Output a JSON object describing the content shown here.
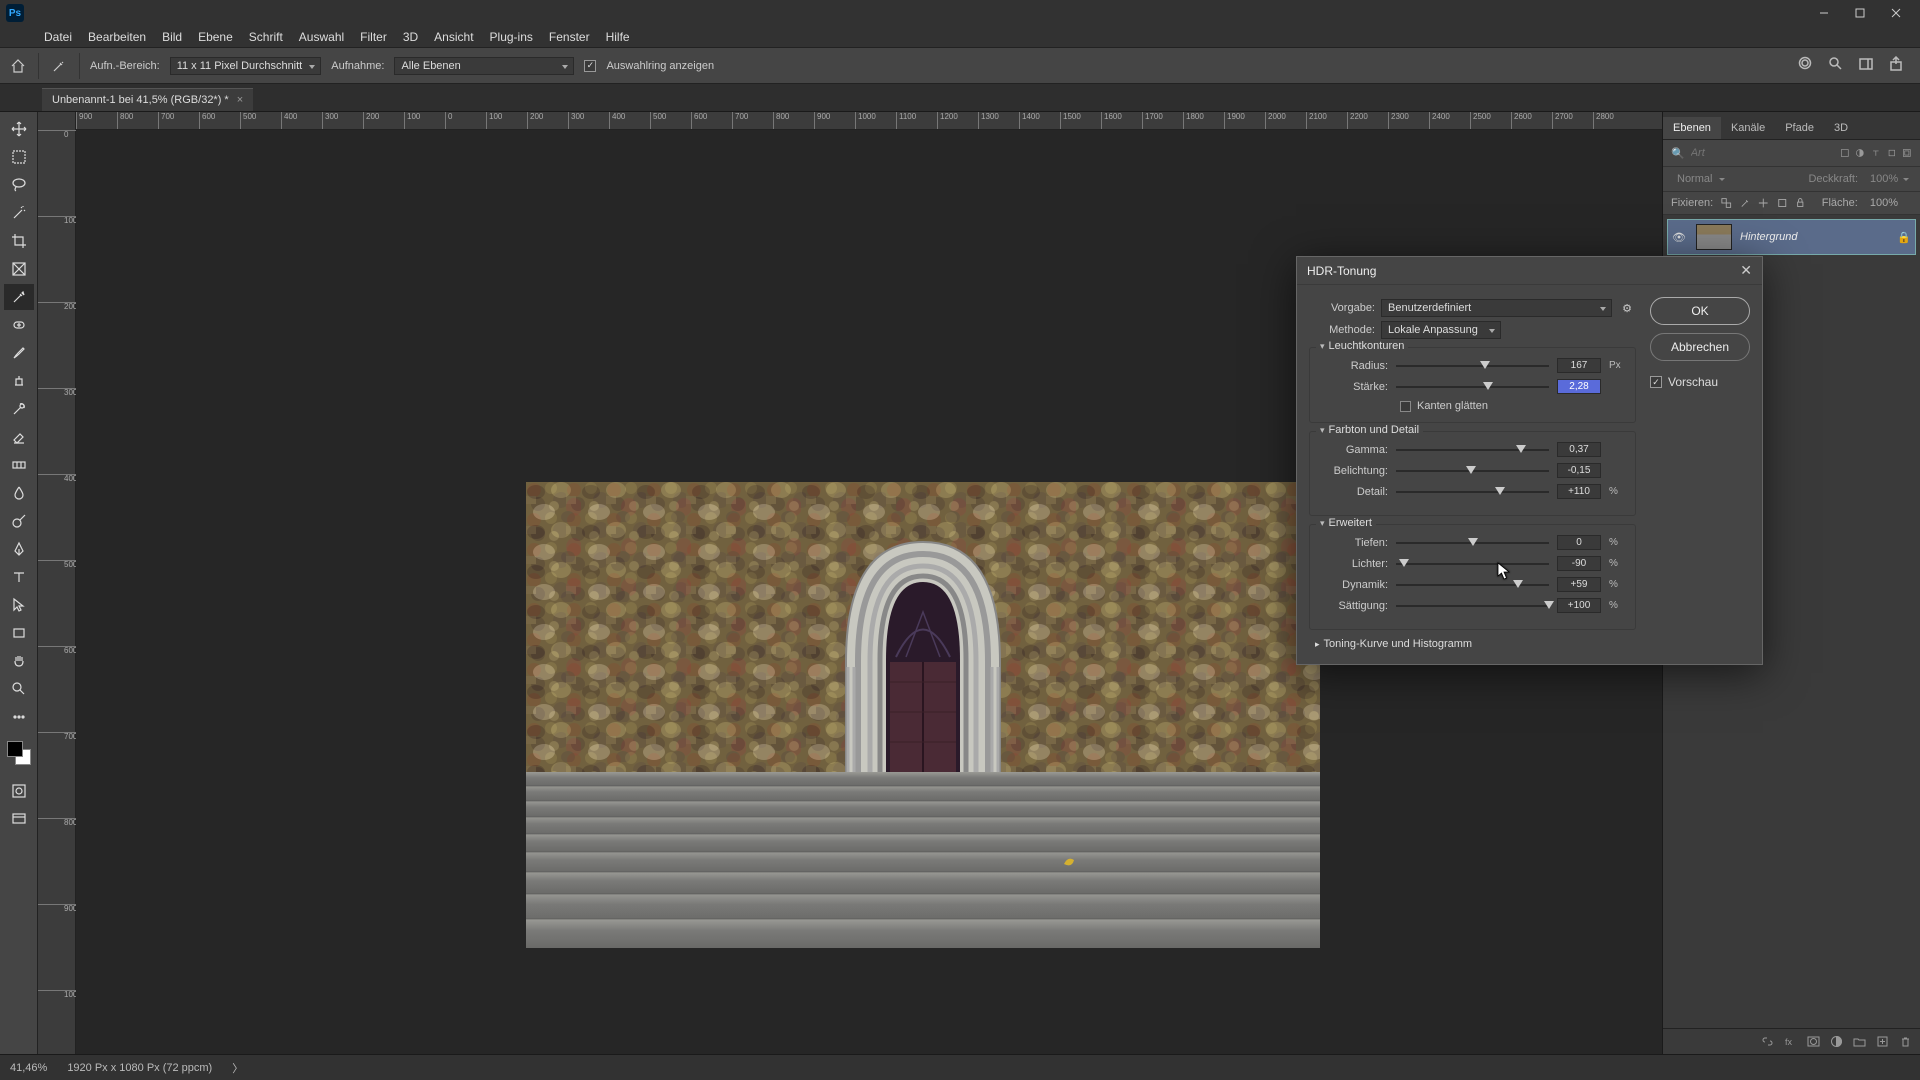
{
  "menubar": [
    "Datei",
    "Bearbeiten",
    "Bild",
    "Ebene",
    "Schrift",
    "Auswahl",
    "Filter",
    "3D",
    "Ansicht",
    "Plug-ins",
    "Fenster",
    "Hilfe"
  ],
  "optionsbar": {
    "sample_label": "Aufn.-Bereich:",
    "sample_value": "11 x 11 Pixel Durchschnitt",
    "sample_target_label": "Aufnahme:",
    "sample_target_value": "Alle Ebenen",
    "show_ring_label": "Auswahlring anzeigen"
  },
  "tab": {
    "title": "Unbenannt-1 bei 41,5% (RGB/32*) *"
  },
  "ruler_h": [
    "900",
    "800",
    "700",
    "600",
    "500",
    "400",
    "300",
    "200",
    "100",
    "0",
    "100",
    "200",
    "300",
    "400",
    "500",
    "600",
    "700",
    "800",
    "900",
    "1000",
    "1100",
    "1200",
    "1300",
    "1400",
    "1500",
    "1600",
    "1700",
    "1800",
    "1900",
    "2000",
    "2100",
    "2200",
    "2300",
    "2400",
    "2500",
    "2600",
    "2700",
    "2800"
  ],
  "ruler_v": [
    "0",
    "100",
    "200",
    "300",
    "400",
    "500",
    "600",
    "700",
    "800",
    "900",
    "1000"
  ],
  "panels": {
    "tabs": [
      "Ebenen",
      "Kanäle",
      "Pfade",
      "3D"
    ],
    "search_placeholder": "Art",
    "blend_mode": "Normal",
    "opacity_label": "Deckkraft:",
    "opacity_value": "100%",
    "lock_label": "Fixieren:",
    "fill_label": "Fläche:",
    "fill_value": "100%",
    "layer_name": "Hintergrund"
  },
  "status": {
    "zoom": "41,46%",
    "doc": "1920 Px x 1080 Px (72 ppcm)"
  },
  "dialog": {
    "title": "HDR-Tonung",
    "preset_label": "Vorgabe:",
    "preset_value": "Benutzerdefiniert",
    "method_label": "Methode:",
    "method_value": "Lokale Anpassung",
    "ok": "OK",
    "cancel": "Abbrechen",
    "preview": "Vorschau",
    "sections": {
      "edge_glow": "Leuchtkonturen",
      "tone_detail": "Farbton und Detail",
      "advanced": "Erweitert",
      "curve": "Toning-Kurve und Histogramm"
    },
    "sliders": {
      "radius": {
        "label": "Radius:",
        "value": "167",
        "unit": "Px",
        "pos": 58
      },
      "strength": {
        "label": "Stärke:",
        "value": "2,28",
        "unit": "",
        "pos": 60
      },
      "smooth_edges": "Kanten glätten",
      "gamma": {
        "label": "Gamma:",
        "value": "0,37",
        "unit": "",
        "pos": 82
      },
      "exposure": {
        "label": "Belichtung:",
        "value": "-0,15",
        "unit": "",
        "pos": 49
      },
      "detail": {
        "label": "Detail:",
        "value": "+110",
        "unit": "%",
        "pos": 68
      },
      "shadow": {
        "label": "Tiefen:",
        "value": "0",
        "unit": "%",
        "pos": 50
      },
      "highlight": {
        "label": "Lichter:",
        "value": "-90",
        "unit": "%",
        "pos": 5
      },
      "vibrance": {
        "label": "Dynamik:",
        "value": "+59",
        "unit": "%",
        "pos": 80
      },
      "saturation": {
        "label": "Sättigung:",
        "value": "+100",
        "unit": "%",
        "pos": 100
      }
    }
  }
}
